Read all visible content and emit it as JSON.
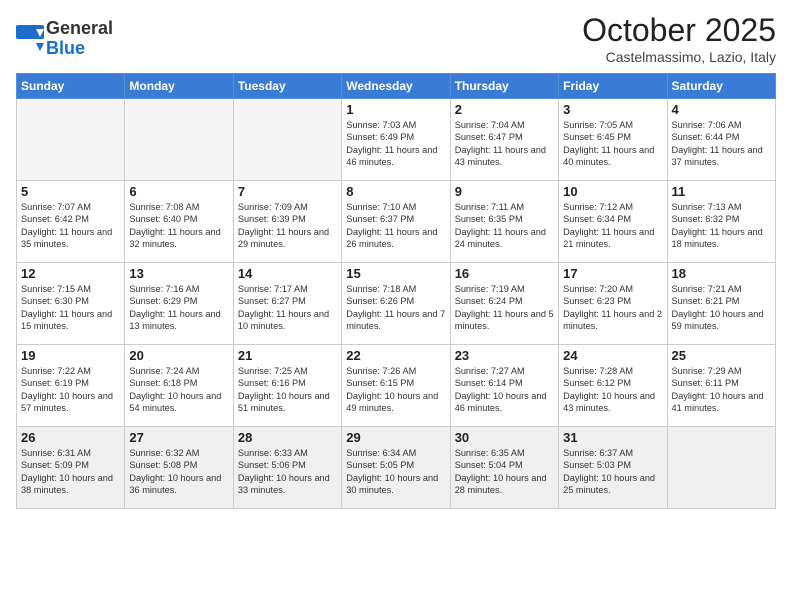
{
  "header": {
    "logo_general": "General",
    "logo_blue": "Blue",
    "month_title": "October 2025",
    "location": "Castelmassimo, Lazio, Italy"
  },
  "days_of_week": [
    "Sunday",
    "Monday",
    "Tuesday",
    "Wednesday",
    "Thursday",
    "Friday",
    "Saturday"
  ],
  "weeks": [
    [
      {
        "day": "",
        "empty": true
      },
      {
        "day": "",
        "empty": true
      },
      {
        "day": "",
        "empty": true
      },
      {
        "day": "1",
        "sunrise": "7:03 AM",
        "sunset": "6:49 PM",
        "daylight": "11 hours and 46 minutes."
      },
      {
        "day": "2",
        "sunrise": "7:04 AM",
        "sunset": "6:47 PM",
        "daylight": "11 hours and 43 minutes."
      },
      {
        "day": "3",
        "sunrise": "7:05 AM",
        "sunset": "6:45 PM",
        "daylight": "11 hours and 40 minutes."
      },
      {
        "day": "4",
        "sunrise": "7:06 AM",
        "sunset": "6:44 PM",
        "daylight": "11 hours and 37 minutes."
      }
    ],
    [
      {
        "day": "5",
        "sunrise": "7:07 AM",
        "sunset": "6:42 PM",
        "daylight": "11 hours and 35 minutes."
      },
      {
        "day": "6",
        "sunrise": "7:08 AM",
        "sunset": "6:40 PM",
        "daylight": "11 hours and 32 minutes."
      },
      {
        "day": "7",
        "sunrise": "7:09 AM",
        "sunset": "6:39 PM",
        "daylight": "11 hours and 29 minutes."
      },
      {
        "day": "8",
        "sunrise": "7:10 AM",
        "sunset": "6:37 PM",
        "daylight": "11 hours and 26 minutes."
      },
      {
        "day": "9",
        "sunrise": "7:11 AM",
        "sunset": "6:35 PM",
        "daylight": "11 hours and 24 minutes."
      },
      {
        "day": "10",
        "sunrise": "7:12 AM",
        "sunset": "6:34 PM",
        "daylight": "11 hours and 21 minutes."
      },
      {
        "day": "11",
        "sunrise": "7:13 AM",
        "sunset": "6:32 PM",
        "daylight": "11 hours and 18 minutes."
      }
    ],
    [
      {
        "day": "12",
        "sunrise": "7:15 AM",
        "sunset": "6:30 PM",
        "daylight": "11 hours and 15 minutes."
      },
      {
        "day": "13",
        "sunrise": "7:16 AM",
        "sunset": "6:29 PM",
        "daylight": "11 hours and 13 minutes."
      },
      {
        "day": "14",
        "sunrise": "7:17 AM",
        "sunset": "6:27 PM",
        "daylight": "11 hours and 10 minutes."
      },
      {
        "day": "15",
        "sunrise": "7:18 AM",
        "sunset": "6:26 PM",
        "daylight": "11 hours and 7 minutes."
      },
      {
        "day": "16",
        "sunrise": "7:19 AM",
        "sunset": "6:24 PM",
        "daylight": "11 hours and 5 minutes."
      },
      {
        "day": "17",
        "sunrise": "7:20 AM",
        "sunset": "6:23 PM",
        "daylight": "11 hours and 2 minutes."
      },
      {
        "day": "18",
        "sunrise": "7:21 AM",
        "sunset": "6:21 PM",
        "daylight": "10 hours and 59 minutes."
      }
    ],
    [
      {
        "day": "19",
        "sunrise": "7:22 AM",
        "sunset": "6:19 PM",
        "daylight": "10 hours and 57 minutes."
      },
      {
        "day": "20",
        "sunrise": "7:24 AM",
        "sunset": "6:18 PM",
        "daylight": "10 hours and 54 minutes."
      },
      {
        "day": "21",
        "sunrise": "7:25 AM",
        "sunset": "6:16 PM",
        "daylight": "10 hours and 51 minutes."
      },
      {
        "day": "22",
        "sunrise": "7:26 AM",
        "sunset": "6:15 PM",
        "daylight": "10 hours and 49 minutes."
      },
      {
        "day": "23",
        "sunrise": "7:27 AM",
        "sunset": "6:14 PM",
        "daylight": "10 hours and 46 minutes."
      },
      {
        "day": "24",
        "sunrise": "7:28 AM",
        "sunset": "6:12 PM",
        "daylight": "10 hours and 43 minutes."
      },
      {
        "day": "25",
        "sunrise": "7:29 AM",
        "sunset": "6:11 PM",
        "daylight": "10 hours and 41 minutes."
      }
    ],
    [
      {
        "day": "26",
        "sunrise": "6:31 AM",
        "sunset": "5:09 PM",
        "daylight": "10 hours and 38 minutes."
      },
      {
        "day": "27",
        "sunrise": "6:32 AM",
        "sunset": "5:08 PM",
        "daylight": "10 hours and 36 minutes."
      },
      {
        "day": "28",
        "sunrise": "6:33 AM",
        "sunset": "5:06 PM",
        "daylight": "10 hours and 33 minutes."
      },
      {
        "day": "29",
        "sunrise": "6:34 AM",
        "sunset": "5:05 PM",
        "daylight": "10 hours and 30 minutes."
      },
      {
        "day": "30",
        "sunrise": "6:35 AM",
        "sunset": "5:04 PM",
        "daylight": "10 hours and 28 minutes."
      },
      {
        "day": "31",
        "sunrise": "6:37 AM",
        "sunset": "5:03 PM",
        "daylight": "10 hours and 25 minutes."
      },
      {
        "day": "",
        "empty": true
      }
    ]
  ]
}
